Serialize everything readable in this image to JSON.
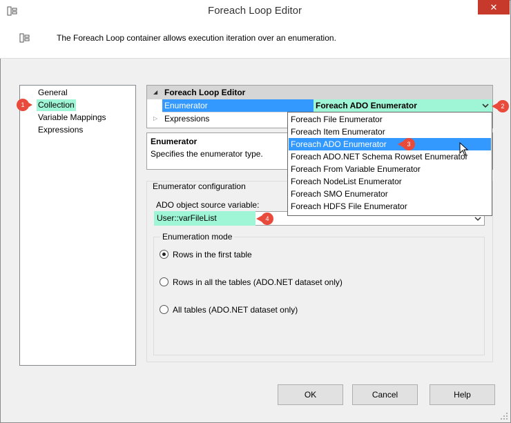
{
  "window": {
    "title": "Foreach Loop Editor",
    "close_glyph": "✕"
  },
  "header": {
    "description": "The Foreach Loop container allows execution iteration over an enumeration."
  },
  "nav": {
    "items": [
      {
        "label": "General",
        "selected": false
      },
      {
        "label": "Collection",
        "selected": true
      },
      {
        "label": "Variable Mappings",
        "selected": false
      },
      {
        "label": "Expressions",
        "selected": false
      }
    ]
  },
  "property_grid": {
    "category": "Foreach Loop Editor",
    "rows": [
      {
        "label": "Enumerator",
        "value": "Foreach ADO Enumerator"
      },
      {
        "label": "Expressions",
        "value": ""
      }
    ]
  },
  "description_panel": {
    "title": "Enumerator",
    "text": "Specifies the enumerator type."
  },
  "enumerator_dropdown": {
    "options": [
      "Foreach File Enumerator",
      "Foreach Item Enumerator",
      "Foreach ADO Enumerator",
      "Foreach ADO.NET Schema Rowset Enumerator",
      "Foreach From Variable Enumerator",
      "Foreach NodeList Enumerator",
      "Foreach SMO Enumerator",
      "Foreach HDFS File Enumerator"
    ],
    "highlighted": "Foreach ADO Enumerator"
  },
  "config": {
    "group_title": "Enumerator configuration",
    "source_label": "ADO object source variable:",
    "source_value": "User::varFileList",
    "mode_title": "Enumeration mode",
    "modes": [
      {
        "label": "Rows in the first table",
        "checked": true
      },
      {
        "label": "Rows in all the tables (ADO.NET dataset only)",
        "checked": false
      },
      {
        "label": "All tables (ADO.NET dataset only)",
        "checked": false
      }
    ]
  },
  "buttons": {
    "ok": "OK",
    "cancel": "Cancel",
    "help": "Help"
  },
  "callouts": [
    "1",
    "2",
    "3",
    "4"
  ],
  "colors": {
    "selection": "#9ff6d6",
    "highlight": "#3399ff",
    "callout": "#e84a3c",
    "close": "#c7392b"
  }
}
